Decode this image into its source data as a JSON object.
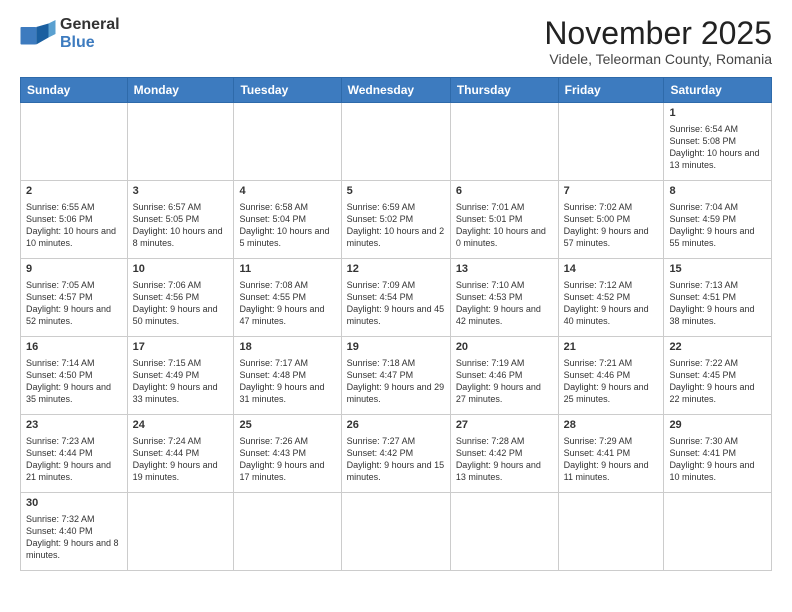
{
  "logo": {
    "line1": "General",
    "line2": "Blue"
  },
  "title": "November 2025",
  "subtitle": "Videle, Teleorman County, Romania",
  "days_of_week": [
    "Sunday",
    "Monday",
    "Tuesday",
    "Wednesday",
    "Thursday",
    "Friday",
    "Saturday"
  ],
  "weeks": [
    [
      {
        "day": "",
        "info": ""
      },
      {
        "day": "",
        "info": ""
      },
      {
        "day": "",
        "info": ""
      },
      {
        "day": "",
        "info": ""
      },
      {
        "day": "",
        "info": ""
      },
      {
        "day": "",
        "info": ""
      },
      {
        "day": "1",
        "info": "Sunrise: 6:54 AM\nSunset: 5:08 PM\nDaylight: 10 hours and 13 minutes."
      }
    ],
    [
      {
        "day": "2",
        "info": "Sunrise: 6:55 AM\nSunset: 5:06 PM\nDaylight: 10 hours and 10 minutes."
      },
      {
        "day": "3",
        "info": "Sunrise: 6:57 AM\nSunset: 5:05 PM\nDaylight: 10 hours and 8 minutes."
      },
      {
        "day": "4",
        "info": "Sunrise: 6:58 AM\nSunset: 5:04 PM\nDaylight: 10 hours and 5 minutes."
      },
      {
        "day": "5",
        "info": "Sunrise: 6:59 AM\nSunset: 5:02 PM\nDaylight: 10 hours and 2 minutes."
      },
      {
        "day": "6",
        "info": "Sunrise: 7:01 AM\nSunset: 5:01 PM\nDaylight: 10 hours and 0 minutes."
      },
      {
        "day": "7",
        "info": "Sunrise: 7:02 AM\nSunset: 5:00 PM\nDaylight: 9 hours and 57 minutes."
      },
      {
        "day": "8",
        "info": "Sunrise: 7:04 AM\nSunset: 4:59 PM\nDaylight: 9 hours and 55 minutes."
      }
    ],
    [
      {
        "day": "9",
        "info": "Sunrise: 7:05 AM\nSunset: 4:57 PM\nDaylight: 9 hours and 52 minutes."
      },
      {
        "day": "10",
        "info": "Sunrise: 7:06 AM\nSunset: 4:56 PM\nDaylight: 9 hours and 50 minutes."
      },
      {
        "day": "11",
        "info": "Sunrise: 7:08 AM\nSunset: 4:55 PM\nDaylight: 9 hours and 47 minutes."
      },
      {
        "day": "12",
        "info": "Sunrise: 7:09 AM\nSunset: 4:54 PM\nDaylight: 9 hours and 45 minutes."
      },
      {
        "day": "13",
        "info": "Sunrise: 7:10 AM\nSunset: 4:53 PM\nDaylight: 9 hours and 42 minutes."
      },
      {
        "day": "14",
        "info": "Sunrise: 7:12 AM\nSunset: 4:52 PM\nDaylight: 9 hours and 40 minutes."
      },
      {
        "day": "15",
        "info": "Sunrise: 7:13 AM\nSunset: 4:51 PM\nDaylight: 9 hours and 38 minutes."
      }
    ],
    [
      {
        "day": "16",
        "info": "Sunrise: 7:14 AM\nSunset: 4:50 PM\nDaylight: 9 hours and 35 minutes."
      },
      {
        "day": "17",
        "info": "Sunrise: 7:15 AM\nSunset: 4:49 PM\nDaylight: 9 hours and 33 minutes."
      },
      {
        "day": "18",
        "info": "Sunrise: 7:17 AM\nSunset: 4:48 PM\nDaylight: 9 hours and 31 minutes."
      },
      {
        "day": "19",
        "info": "Sunrise: 7:18 AM\nSunset: 4:47 PM\nDaylight: 9 hours and 29 minutes."
      },
      {
        "day": "20",
        "info": "Sunrise: 7:19 AM\nSunset: 4:46 PM\nDaylight: 9 hours and 27 minutes."
      },
      {
        "day": "21",
        "info": "Sunrise: 7:21 AM\nSunset: 4:46 PM\nDaylight: 9 hours and 25 minutes."
      },
      {
        "day": "22",
        "info": "Sunrise: 7:22 AM\nSunset: 4:45 PM\nDaylight: 9 hours and 22 minutes."
      }
    ],
    [
      {
        "day": "23",
        "info": "Sunrise: 7:23 AM\nSunset: 4:44 PM\nDaylight: 9 hours and 21 minutes."
      },
      {
        "day": "24",
        "info": "Sunrise: 7:24 AM\nSunset: 4:44 PM\nDaylight: 9 hours and 19 minutes."
      },
      {
        "day": "25",
        "info": "Sunrise: 7:26 AM\nSunset: 4:43 PM\nDaylight: 9 hours and 17 minutes."
      },
      {
        "day": "26",
        "info": "Sunrise: 7:27 AM\nSunset: 4:42 PM\nDaylight: 9 hours and 15 minutes."
      },
      {
        "day": "27",
        "info": "Sunrise: 7:28 AM\nSunset: 4:42 PM\nDaylight: 9 hours and 13 minutes."
      },
      {
        "day": "28",
        "info": "Sunrise: 7:29 AM\nSunset: 4:41 PM\nDaylight: 9 hours and 11 minutes."
      },
      {
        "day": "29",
        "info": "Sunrise: 7:30 AM\nSunset: 4:41 PM\nDaylight: 9 hours and 10 minutes."
      }
    ],
    [
      {
        "day": "30",
        "info": "Sunrise: 7:32 AM\nSunset: 4:40 PM\nDaylight: 9 hours and 8 minutes."
      },
      {
        "day": "",
        "info": ""
      },
      {
        "day": "",
        "info": ""
      },
      {
        "day": "",
        "info": ""
      },
      {
        "day": "",
        "info": ""
      },
      {
        "day": "",
        "info": ""
      },
      {
        "day": "",
        "info": ""
      }
    ]
  ]
}
